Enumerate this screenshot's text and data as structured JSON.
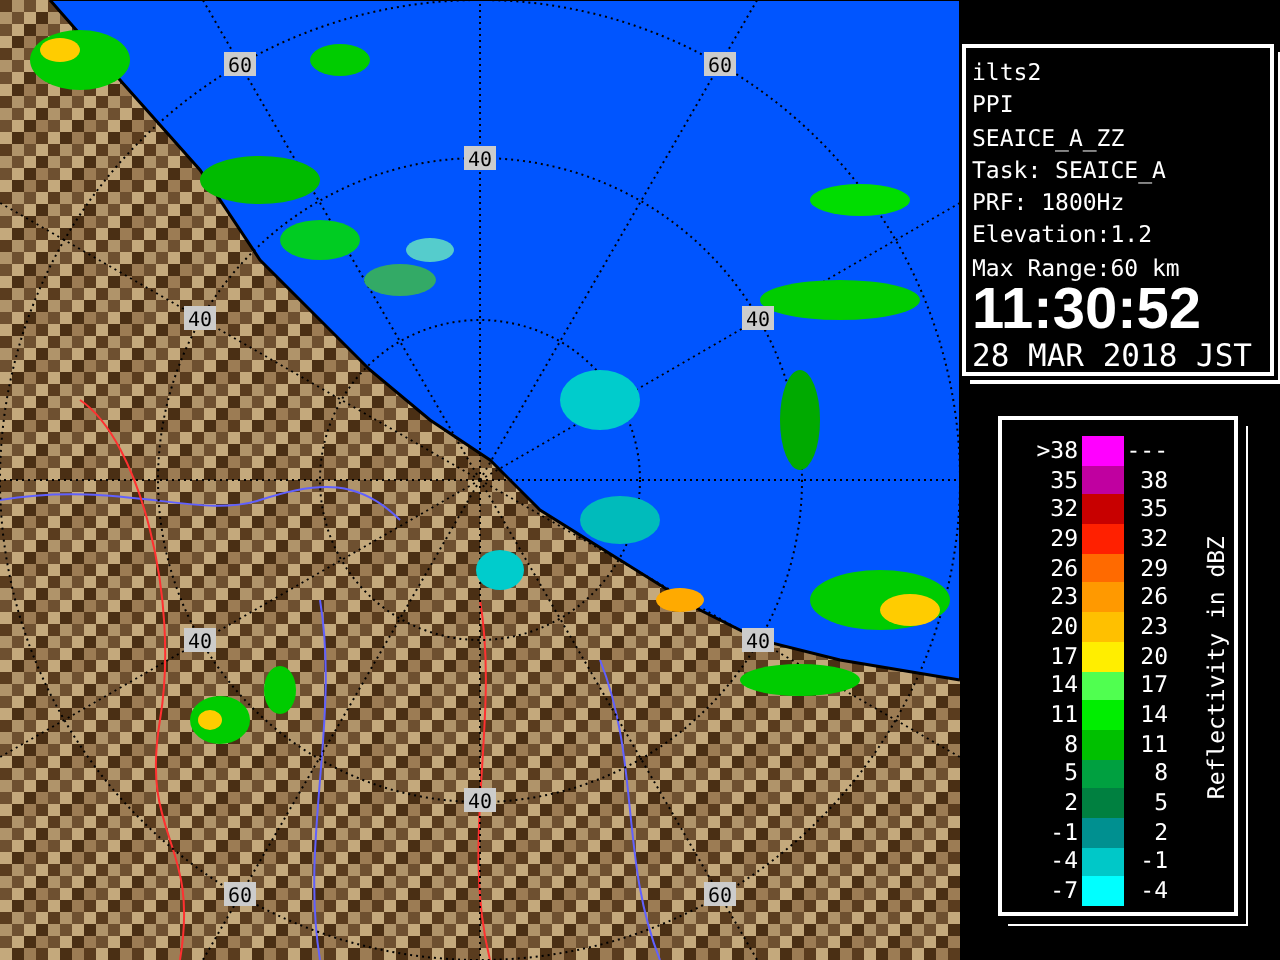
{
  "map": {
    "range_labels": [
      "60",
      "60",
      "40",
      "40",
      "40",
      "40",
      "40",
      "40",
      "60",
      "60"
    ]
  },
  "info": {
    "station": "ilts2",
    "mode": "PPI",
    "product": "SEAICE_A_ZZ",
    "task": "Task: SEAICE_A",
    "prf": "PRF: 1800Hz",
    "elevation": "Elevation:1.2",
    "max_range": "Max Range:60 km",
    "time": "11:30:52",
    "date": "28 MAR 2018 JST"
  },
  "legend": {
    "title": "Reflectivity in dBZ",
    "rows": [
      {
        "low": ">38",
        "high": "---",
        "color": "#ff00ff"
      },
      {
        "low": "35",
        "high": "38",
        "color": "#c000a0"
      },
      {
        "low": "32",
        "high": "35",
        "color": "#c80000"
      },
      {
        "low": "29",
        "high": "32",
        "color": "#ff2000"
      },
      {
        "low": "26",
        "high": "29",
        "color": "#ff6a00"
      },
      {
        "low": "23",
        "high": "26",
        "color": "#ff9900"
      },
      {
        "low": "20",
        "high": "23",
        "color": "#ffc000"
      },
      {
        "low": "17",
        "high": "20",
        "color": "#ffee00"
      },
      {
        "low": "14",
        "high": "17",
        "color": "#50ff50"
      },
      {
        "low": "11",
        "high": "14",
        "color": "#00ee00"
      },
      {
        "low": "8",
        "high": "11",
        "color": "#00c000"
      },
      {
        "low": "5",
        "high": "8",
        "color": "#00a040"
      },
      {
        "low": "2",
        "high": "5",
        "color": "#008040"
      },
      {
        "low": "-1",
        "high": "2",
        "color": "#009090"
      },
      {
        "low": "-4",
        "high": "-1",
        "color": "#00c8c8"
      },
      {
        "low": "-7",
        "high": "-4",
        "color": "#00ffff"
      }
    ]
  }
}
